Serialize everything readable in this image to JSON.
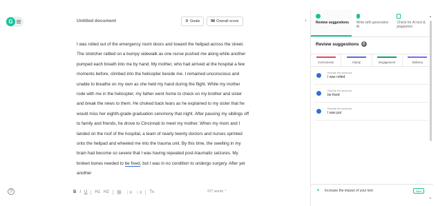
{
  "app": {
    "logo_letter": "G",
    "help_glyph": "?"
  },
  "document": {
    "title": "Untitled document",
    "goals_label": "Goals",
    "score_value": "98",
    "score_label": "Overall score",
    "word_count": "227 words",
    "body_pre": "I was rolled out of the emergency room doors and toward the helipad across the street. The stretcher rattled on a bumpy sidewalk as one nurse pushed me along while another pumped each breath into me by hand. My mother, who had arrived at the hospital a few moments before, climbed into the helicopter beside me. I remained unconscious and unable to breathe on my own as she held my hand during the flight. While my mother rode with me in the helicopter, my father went home to check on my brother and sister and break the news to them. He choked back tears as he explained to my sister that he would miss her eighth-grade graduation ceremony that night. After passing my siblings off to family and friends, he drove to Cincinnati to meet my mother. When my mom and I landed on the roof of the hospital, a team of nearly twenty doctors and nurses sprinted onto the helipad and wheeled me into the trauma unit. By this time, the swelling in my brain had become so severe that I was having repeated post-traumatic seizures. My broken bones needed to ",
    "body_flag": "be fixed",
    "body_post": ", but I was in no condition to undergo surgery. After yet another"
  },
  "toolbar": {
    "bold": "B",
    "italic": "I",
    "underline": "U",
    "h1": "H1",
    "h2": "H2",
    "link": "⛓",
    "ol": "⋮≡",
    "ul": "⋮≡",
    "clear": "Tx"
  },
  "panel": {
    "tabs": [
      {
        "label": "Review suggestions",
        "color": "#15c39a"
      },
      {
        "label": "Write with generative AI",
        "color": "#15c39a"
      },
      {
        "label": "Check for AI text & plagiarism",
        "color": "#15c39a"
      }
    ],
    "heading": "Review suggestions",
    "count": "3",
    "categories": [
      {
        "label": "Correctness",
        "color": "#e5484d"
      },
      {
        "label": "Clarity",
        "color": "#4a6ee0"
      },
      {
        "label": "Engagement",
        "color": "#0f9c7b"
      },
      {
        "label": "Delivery",
        "color": "#8b5cf6"
      }
    ],
    "suggestions": [
      {
        "hint": "Rewrite the sentence",
        "text": "I was rolled"
      },
      {
        "hint": "Rewrite the sentence",
        "text": "be fixed"
      },
      {
        "hint": "Rewrite the sentence",
        "text": "I was put"
      }
    ],
    "footer_text": "Increase the impact of your text",
    "footer_badge": "New",
    "collapse_glyph": "›"
  }
}
